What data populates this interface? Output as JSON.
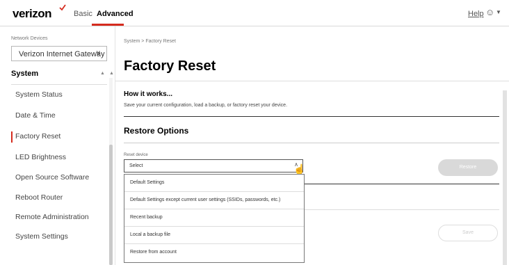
{
  "header": {
    "logo": "verizon",
    "nav_basic": "Basic",
    "nav_advanced": "Advanced",
    "help": "Help",
    "accent_color": "#d52b1e"
  },
  "sidebar": {
    "label": "Network Devices",
    "device_select": "Verizon Internet Gateway",
    "section": "System",
    "items": [
      {
        "label": "System Status"
      },
      {
        "label": "Date & Time"
      },
      {
        "label": "Factory Reset"
      },
      {
        "label": "LED Brightness"
      },
      {
        "label": "Open Source Software"
      },
      {
        "label": "Reboot Router"
      },
      {
        "label": "Remote Administration"
      },
      {
        "label": "System Settings"
      }
    ],
    "active_item": "Factory Reset"
  },
  "main": {
    "breadcrumb": "System  >  Factory Reset",
    "title": "Factory Reset",
    "how_title": "How it works...",
    "how_desc": "Save your current configuration, load a backup, or factory reset your device.",
    "restore_title": "Restore Options",
    "reset_label": "Reset device",
    "select_value": "Select",
    "restore_button": "Restore",
    "save_button": "Save"
  },
  "dropdown": {
    "options": [
      "Default Settings",
      "Default Settings except current user settings (SSIDs, passwords, etc.)",
      "Recent backup",
      "Local a backup file",
      "Restore from account"
    ]
  }
}
